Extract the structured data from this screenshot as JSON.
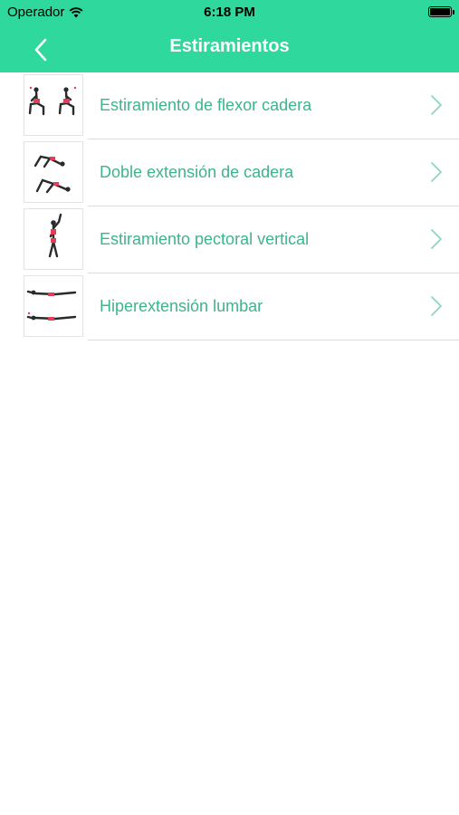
{
  "status_bar": {
    "carrier": "Operador",
    "time": "6:18 PM",
    "battery_level": 1.0
  },
  "nav": {
    "title": "Estiramientos",
    "back_icon": "chevron-left-icon"
  },
  "colors": {
    "accent": "#2fd89c",
    "label": "#3db48a",
    "chevron": "#8ed6bf",
    "divider": "#dcdcdc"
  },
  "exercises": [
    {
      "label": "Estiramiento de flexor cadera",
      "thumbnail": "lunge-stretch-image"
    },
    {
      "label": "Doble extensión de cadera",
      "thumbnail": "hip-bridge-image"
    },
    {
      "label": "Estiramiento pectoral vertical",
      "thumbnail": "standing-chest-stretch-image"
    },
    {
      "label": "Hiperextensión lumbar",
      "thumbnail": "back-extension-image"
    }
  ]
}
